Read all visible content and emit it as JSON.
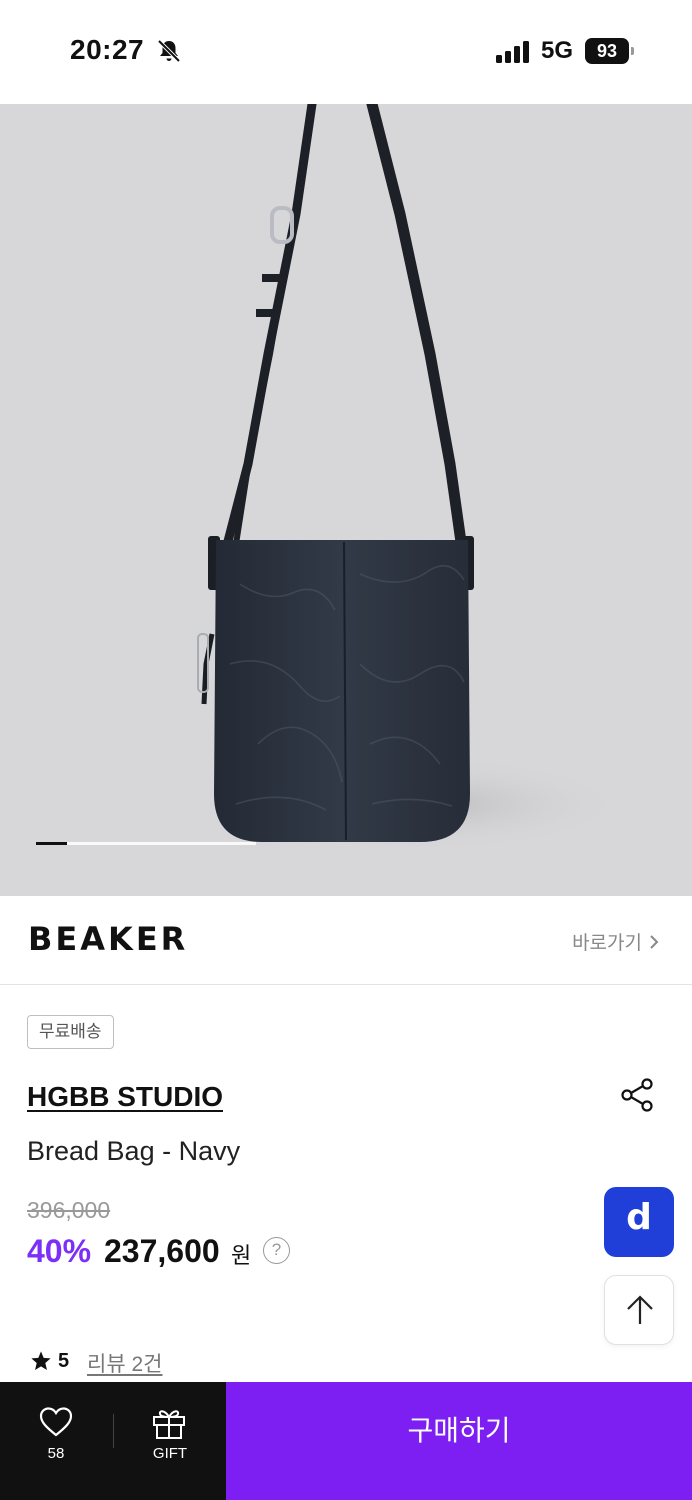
{
  "status_bar": {
    "time": "20:27",
    "network": "5G",
    "battery": "93"
  },
  "gallery": {
    "image_alt": "Bread Bag - Navy product photo",
    "progress": 0.14,
    "bag_color": "#2b323d"
  },
  "brand_bar": {
    "logo": "BEAKER",
    "shortcut_label": "바로가기"
  },
  "product": {
    "shipping_badge": "무료배송",
    "brand": "HGBB STUDIO",
    "name": "Bread Bag - Navy",
    "original_price": "396,000",
    "discount": "40%",
    "sale_price": "237,600",
    "currency_unit": "원",
    "help_icon": "?",
    "rating": "5",
    "review_link": "리뷰 2건"
  },
  "floating": {
    "d_button": "d"
  },
  "bottom_bar": {
    "like_count": "58",
    "gift_label": "GIFT",
    "buy_label": "구매하기"
  },
  "colors": {
    "accent": "#7d1ff2",
    "discount": "#7b2ff7",
    "d_button": "#1f3fd8",
    "image_bg": "#d7d7d9"
  }
}
